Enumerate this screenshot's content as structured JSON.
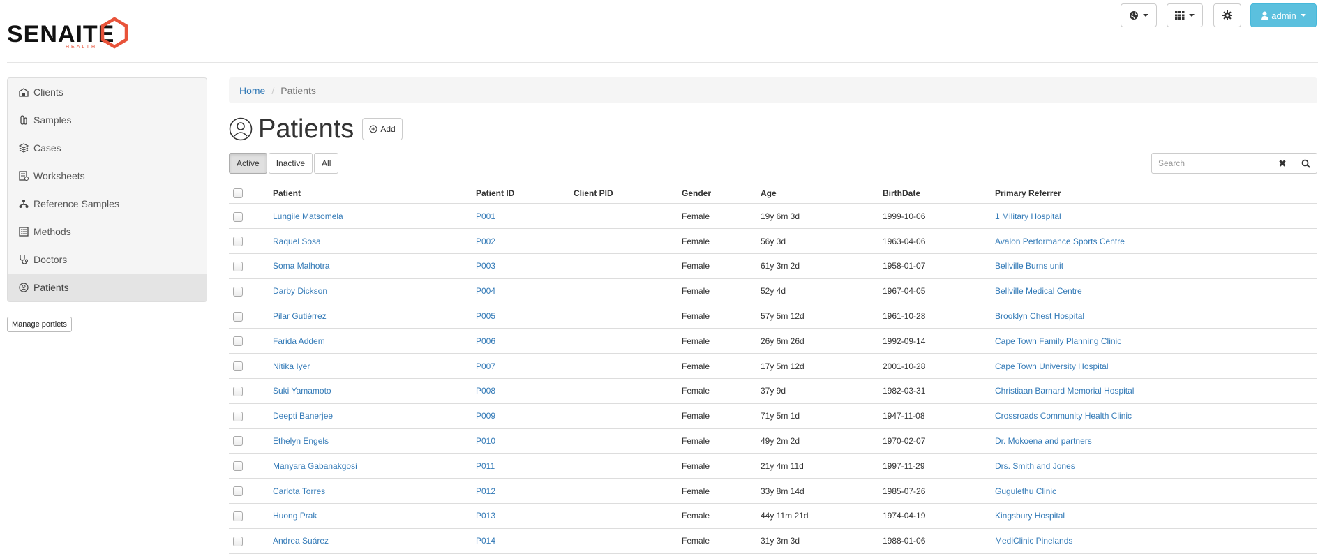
{
  "brand": {
    "logo_text": "SENAITE",
    "logo_sub": "HEALTH",
    "accent": "#e8533a"
  },
  "topbar": {
    "user_label": "admin"
  },
  "sidebar": {
    "items": [
      {
        "label": "Clients",
        "icon": "clients-icon"
      },
      {
        "label": "Samples",
        "icon": "samples-icon"
      },
      {
        "label": "Cases",
        "icon": "cases-icon"
      },
      {
        "label": "Worksheets",
        "icon": "worksheets-icon"
      },
      {
        "label": "Reference Samples",
        "icon": "reference-samples-icon"
      },
      {
        "label": "Methods",
        "icon": "methods-icon"
      },
      {
        "label": "Doctors",
        "icon": "doctors-icon"
      },
      {
        "label": "Patients",
        "icon": "patients-icon",
        "active": true
      }
    ],
    "manage_label": "Manage portlets"
  },
  "breadcrumb": {
    "home": "Home",
    "current": "Patients"
  },
  "page": {
    "title": "Patients",
    "add_label": "Add"
  },
  "filters": {
    "active": "Active",
    "inactive": "Inactive",
    "all": "All"
  },
  "search": {
    "placeholder": "Search"
  },
  "table": {
    "columns": [
      "Patient",
      "Patient ID",
      "Client PID",
      "Gender",
      "Age",
      "BirthDate",
      "Primary Referrer"
    ],
    "rows": [
      [
        "Lungile Matsomela",
        "P001",
        "",
        "Female",
        "19y 6m 3d",
        "1999-10-06",
        "1 Military Hospital"
      ],
      [
        "Raquel Sosa",
        "P002",
        "",
        "Female",
        "56y 3d",
        "1963-04-06",
        "Avalon Performance Sports Centre"
      ],
      [
        "Soma Malhotra",
        "P003",
        "",
        "Female",
        "61y 3m 2d",
        "1958-01-07",
        "Bellville Burns unit"
      ],
      [
        "Darby Dickson",
        "P004",
        "",
        "Female",
        "52y 4d",
        "1967-04-05",
        "Bellville Medical Centre"
      ],
      [
        "Pilar Gutiérrez",
        "P005",
        "",
        "Female",
        "57y 5m 12d",
        "1961-10-28",
        "Brooklyn Chest Hospital"
      ],
      [
        "Farida Addem",
        "P006",
        "",
        "Female",
        "26y 6m 26d",
        "1992-09-14",
        "Cape Town Family Planning Clinic"
      ],
      [
        "Nitika Iyer",
        "P007",
        "",
        "Female",
        "17y 5m 12d",
        "2001-10-28",
        "Cape Town University Hospital"
      ],
      [
        "Suki Yamamoto",
        "P008",
        "",
        "Female",
        "37y 9d",
        "1982-03-31",
        "Christiaan Barnard Memorial Hospital"
      ],
      [
        "Deepti Banerjee",
        "P009",
        "",
        "Female",
        "71y 5m 1d",
        "1947-11-08",
        "Crossroads Community Health Clinic"
      ],
      [
        "Ethelyn Engels",
        "P010",
        "",
        "Female",
        "49y 2m 2d",
        "1970-02-07",
        "Dr. Mokoena and partners"
      ],
      [
        "Manyara Gabanakgosi",
        "P011",
        "",
        "Female",
        "21y 4m 11d",
        "1997-11-29",
        "Drs. Smith and Jones"
      ],
      [
        "Carlota Torres",
        "P012",
        "",
        "Female",
        "33y 8m 14d",
        "1985-07-26",
        "Gugulethu Clinic"
      ],
      [
        "Huong Prak",
        "P013",
        "",
        "Female",
        "44y 11m 21d",
        "1974-04-19",
        "Kingsbury Hospital"
      ],
      [
        "Andrea Suárez",
        "P014",
        "",
        "Female",
        "31y 3m 3d",
        "1988-01-06",
        "MediClinic Pinelands"
      ]
    ]
  }
}
